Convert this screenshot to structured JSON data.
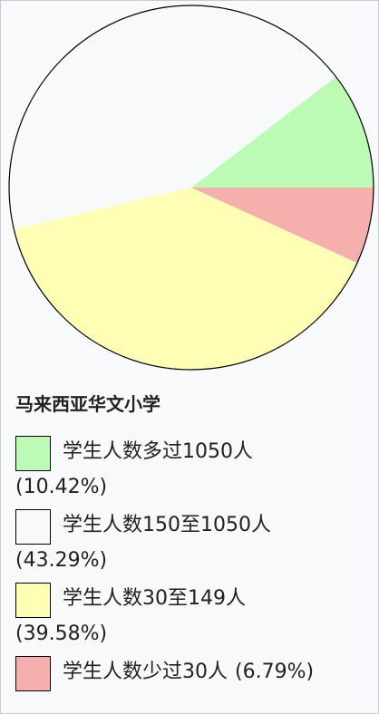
{
  "chart_data": {
    "type": "pie",
    "title": "马来西亚华文小学",
    "slices": [
      {
        "label": "学生人数多过1050人",
        "percent_text": "(10.42%)",
        "value": 10.42,
        "color": "#bbfbb6"
      },
      {
        "label": "学生人数150至1050人",
        "percent_text": "(43.29%)",
        "value": 43.29,
        "color": "#f8f9fa"
      },
      {
        "label": "学生人数30至149人",
        "percent_text": "(39.58%)",
        "value": 39.58,
        "color": "#fefeb5"
      },
      {
        "label": "学生人数少过30人",
        "percent_text": "(6.79%)",
        "value": 6.79,
        "color": "#f5afad"
      }
    ]
  }
}
